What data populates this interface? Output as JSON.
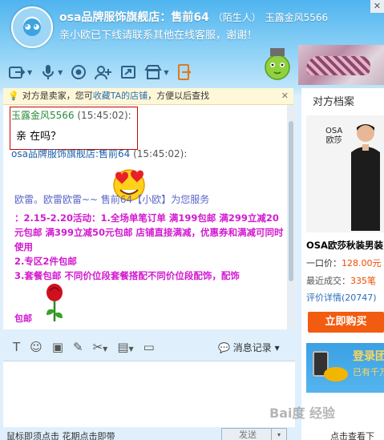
{
  "header": {
    "shop_name": "osa品牌服饰旗舰店：售前64",
    "stranger_tag": "（陌生人）",
    "user_id": "玉露金风5566",
    "status_text": "亲小欧已下线请联系其他在线客服，谢谢！",
    "close_glyph": "✕"
  },
  "toolbar": {
    "icons": [
      "transfer-icon",
      "microphone-icon",
      "camera-icon",
      "add-contact-icon",
      "share-icon",
      "shop-icon",
      "exit-icon"
    ]
  },
  "notice": {
    "text_before": "对方是卖家，您可",
    "link_text": "收藏TA的店铺",
    "text_after": "，方便以后查找",
    "close": "✕"
  },
  "chat": {
    "messages": [
      {
        "sender": "玉露金风5566",
        "time": "(15:45:02):",
        "text": "亲  在吗？"
      },
      {
        "sender": "osa品牌服饰旗舰店:售前64",
        "time": "(15:45:02):"
      }
    ],
    "reply_text": "欧雷。欧雷欧雷~~                       售前64【小欧】为您服务",
    "promo_lines": [
      "：2.15-2.20活动：1.全场单笔订单  满199包邮  满299立减20元包邮   满399立减50元包邮  店铺直接满减，优惠券和满减可同时使用",
      "2.专区2件包邮",
      "3.套餐包邮  不同价位段套餐搭配不同价位段配饰，配饰"
    ],
    "clipped_line": "包邮"
  },
  "side_panel": {
    "title": "对方档案",
    "brand_line1": "OSA",
    "brand_line2": "欧莎",
    "product_name": "OSA欧莎秋装男装",
    "price_label": "一口价：",
    "price_value": "128.00元",
    "deals_label": "最近成交：",
    "deals_value": "335笔",
    "rating_text": "评价详情(20747)",
    "buy_button": "立即购买",
    "ad_line1": "登录团",
    "ad_line2": "已有千万"
  },
  "input_toolbar": {
    "history_label": "消息记录",
    "history_caret": "▾"
  },
  "bottom": {
    "left_text": "鼠标即须点击 花期点击即带",
    "send_label": "发送",
    "send_caret": "▾",
    "right_text": "点击查看下"
  },
  "watermark": "Bai度 经验"
}
